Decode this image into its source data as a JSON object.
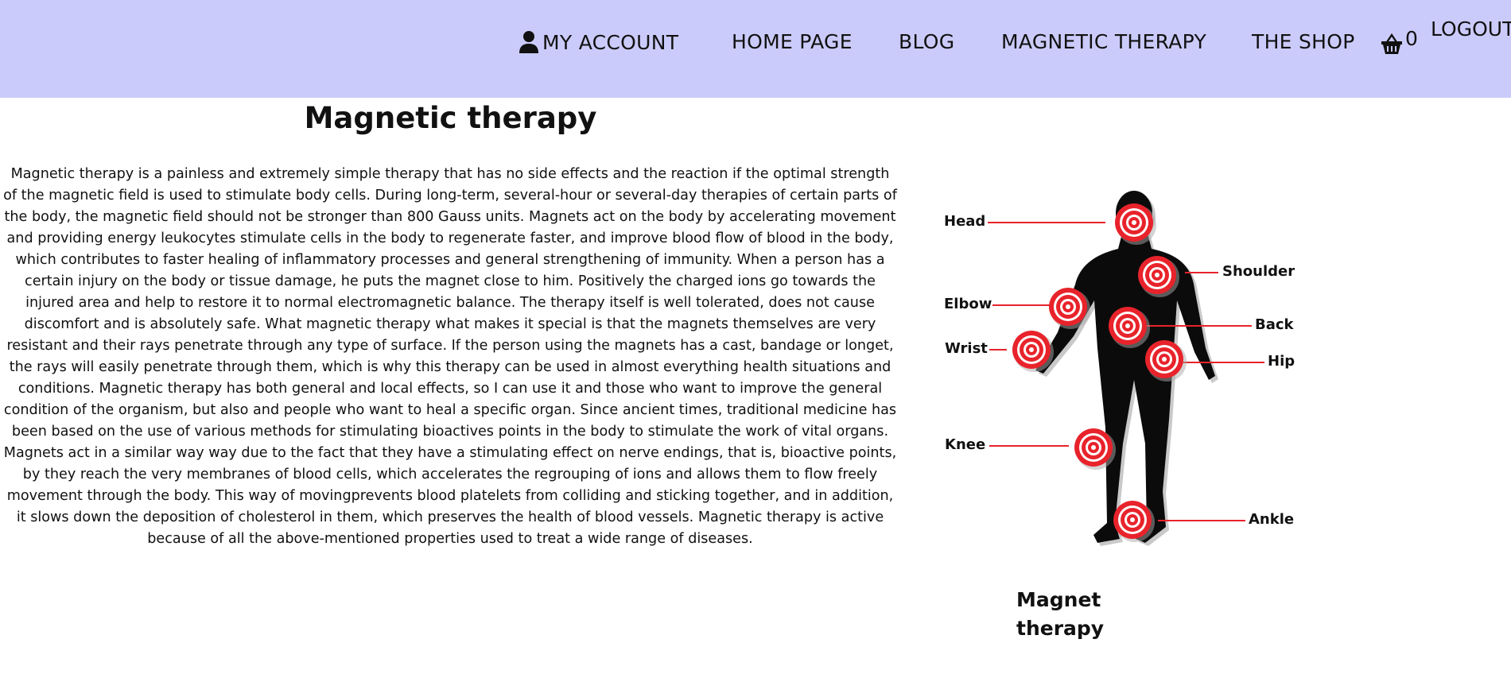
{
  "nav": {
    "my_account": "MY ACCOUNT",
    "home_page": "HOME PAGE",
    "blog": "BLOG",
    "magnetic_therapy": "MAGNETIC THERAPY",
    "the_shop": "THE SHOP",
    "cart_count": "0",
    "logout": "LOGOUT",
    "background_color": "#cbcbfb"
  },
  "main": {
    "title": "Magnetic therapy",
    "body": "Magnetic therapy is a painless and extremely simple therapy that has no side effects and the reaction if the optimal strength of the magnetic field is used to stimulate body cells. During long-term, several-hour or several-day therapies of certain parts of the body, the magnetic field should not be stronger than 800 Gauss units. Magnets act on the body by accelerating movement and providing energy leukocytes stimulate cells in the body to regenerate faster, and improve blood flow of blood in the body, which contributes to faster healing of inflammatory processes and general strengthening of immunity. When a person has a certain injury on the body or tissue damage, he puts the magnet close to him. Positively the charged ions go towards the injured area and help to restore it to normal electromagnetic balance. The therapy itself is well tolerated, does not cause discomfort and is absolutely safe. What magnetic therapy what makes it special is that the magnets themselves are very resistant and their rays penetrate through any type of surface. If the person using the magnets has a cast, bandage or longet, the rays will easily penetrate through them, which is why this therapy can be used in almost everything health situations and conditions. Magnetic therapy has both general and local effects, so I can use it and those who want to improve the general condition of the organism, but also and people who want to heal a specific organ. Since ancient times, traditional medicine has been based on the use of various methods for stimulating bioactives points in the body to stimulate the work of vital organs. Magnets act in a similar way way due to the fact that they have a stimulating effect on nerve endings, that is, bioactive points, by they reach the very membranes of blood cells, which accelerates the regrouping of ions and allows them to flow freely movement through the body. This way of movingprevents blood platelets from colliding and sticking together, and in addition, it slows down the deposition of cholesterol in them, which preserves the health of blood vessels. Magnetic therapy is active because of all the above-mentioned properties used to treat a wide range of diseases."
  },
  "figure": {
    "labels": {
      "head": "Head",
      "shoulder": "Shoulder",
      "elbow": "Elbow",
      "back": "Back",
      "wrist": "Wrist",
      "hip": "Hip",
      "knee": "Knee",
      "ankle": "Ankle"
    },
    "target_color": "#e8232b",
    "caption": "Magnet therapy"
  },
  "icons": {
    "account": "user-icon",
    "cart": "basket-icon"
  }
}
